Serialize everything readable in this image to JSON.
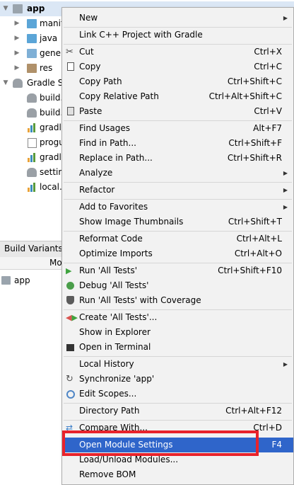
{
  "project_tree": {
    "root_label": "app",
    "items": [
      {
        "label": "manif"
      },
      {
        "label": "java"
      },
      {
        "label": "gener"
      },
      {
        "label": "res"
      }
    ],
    "gradle_root_label": "Gradle Sc",
    "gradle_items": [
      {
        "label": "build."
      },
      {
        "label": "build."
      },
      {
        "label": "gradle"
      },
      {
        "label": "progu"
      },
      {
        "label": "gradle"
      },
      {
        "label": "setting"
      },
      {
        "label": "local.p"
      }
    ]
  },
  "build_variants": {
    "title": "Build Variants",
    "column_header": "Mo",
    "row_label": "app"
  },
  "context_menu": {
    "new": "New",
    "link_cpp": "Link C++ Project with Gradle",
    "cut": "Cut",
    "cut_shortcut": "Ctrl+X",
    "copy": "Copy",
    "copy_shortcut": "Ctrl+C",
    "copy_path": "Copy Path",
    "copy_path_shortcut": "Ctrl+Shift+C",
    "copy_relative_path": "Copy Relative Path",
    "copy_relative_path_shortcut": "Ctrl+Alt+Shift+C",
    "paste": "Paste",
    "paste_shortcut": "Ctrl+V",
    "find_usages": "Find Usages",
    "find_usages_shortcut": "Alt+F7",
    "find_in_path": "Find in Path...",
    "find_in_path_shortcut": "Ctrl+Shift+F",
    "replace_in_path": "Replace in Path...",
    "replace_in_path_shortcut": "Ctrl+Shift+R",
    "analyze": "Analyze",
    "refactor": "Refactor",
    "add_to_favorites": "Add to Favorites",
    "show_image_thumbnails": "Show Image Thumbnails",
    "show_image_thumbnails_shortcut": "Ctrl+Shift+T",
    "reformat_code": "Reformat Code",
    "reformat_code_shortcut": "Ctrl+Alt+L",
    "optimize_imports": "Optimize Imports",
    "optimize_imports_shortcut": "Ctrl+Alt+O",
    "run_all_tests": "Run 'All Tests'",
    "run_all_tests_shortcut": "Ctrl+Shift+F10",
    "debug_all_tests": "Debug 'All Tests'",
    "run_all_tests_coverage": "Run 'All Tests' with Coverage",
    "create_all_tests": "Create 'All Tests'...",
    "show_in_explorer": "Show in Explorer",
    "open_in_terminal": "Open in Terminal",
    "local_history": "Local History",
    "synchronize": "Synchronize 'app'",
    "edit_scopes": "Edit Scopes...",
    "directory_path": "Directory Path",
    "directory_path_shortcut": "Ctrl+Alt+F12",
    "compare_with": "Compare With...",
    "compare_with_shortcut": "Ctrl+D",
    "open_module_settings": "Open Module Settings",
    "open_module_settings_shortcut": "F4",
    "load_unload_modules": "Load/Unload Modules...",
    "remove_bom": "Remove BOM"
  },
  "colors": {
    "selection": "#2f65ca",
    "highlight_box": "#e8232b",
    "run_green": "#3fa33f"
  }
}
